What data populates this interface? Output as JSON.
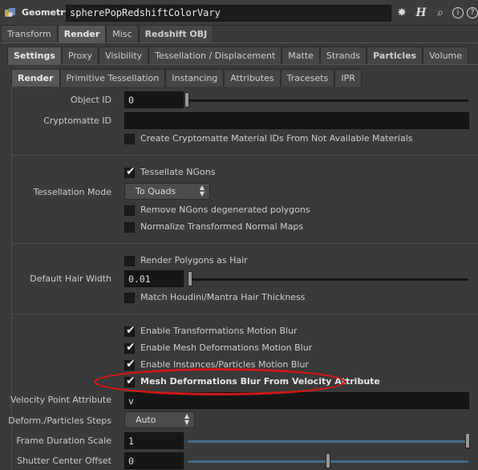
{
  "header": {
    "node_type": "Geometry",
    "node_name": "spherePopRedshiftColorVary",
    "icons": [
      "gear-icon",
      "help-h-icon",
      "search-icon",
      "info-icon",
      "help-icon"
    ]
  },
  "tabs_top": [
    {
      "label": "Transform",
      "active": false
    },
    {
      "label": "Render",
      "active": true
    },
    {
      "label": "Misc",
      "active": false
    },
    {
      "label": "Redshift OBJ",
      "active": false,
      "bold": true
    }
  ],
  "tabs_mid": [
    {
      "label": "Settings",
      "active": true
    },
    {
      "label": "Proxy",
      "active": false
    },
    {
      "label": "Visibility",
      "active": false
    },
    {
      "label": "Tessellation / Displacement",
      "active": false
    },
    {
      "label": "Matte",
      "active": false
    },
    {
      "label": "Strands",
      "active": false
    },
    {
      "label": "Particles",
      "active": false,
      "bold": true
    },
    {
      "label": "Volume",
      "active": false
    }
  ],
  "tabs_sub": [
    {
      "label": "Render",
      "active": true
    },
    {
      "label": "Primitive Tessellation",
      "active": false
    },
    {
      "label": "Instancing",
      "active": false
    },
    {
      "label": "Attributes",
      "active": false
    },
    {
      "label": "Tracesets",
      "active": false
    },
    {
      "label": "IPR",
      "active": false
    }
  ],
  "params": {
    "object_id": {
      "label": "Object ID",
      "value": "0",
      "slider_fraction": 0.0
    },
    "cryptomatte_id": {
      "label": "Cryptomatte ID",
      "value": ""
    },
    "create_crypto": {
      "label": "Create Cryptomatte Material IDs From Not Available Materials",
      "checked": false
    },
    "tessellate_ngons": {
      "label": "Tessellate NGons",
      "checked": true
    },
    "tessellation_mode": {
      "label": "Tessellation Mode",
      "value": "To Quads"
    },
    "remove_ngons": {
      "label": "Remove NGons degenerated polygons",
      "checked": false
    },
    "normalize_normals": {
      "label": "Normalize Transformed Normal Maps",
      "checked": false
    },
    "render_polygons_hair": {
      "label": "Render Polygons as Hair",
      "checked": false
    },
    "default_hair_width": {
      "label": "Default Hair Width",
      "value": "0.01"
    },
    "match_houdini": {
      "label": "Match Houdini/Mantra Hair Thickness",
      "checked": false
    },
    "enable_transform_mb": {
      "label": "Enable Transformations Motion Blur",
      "checked": true
    },
    "enable_mesh_mb": {
      "label": "Enable Mesh Deformations Motion Blur",
      "checked": true
    },
    "enable_instances_mb": {
      "label": "Enable Instances/Particles Motion Blur",
      "checked": true
    },
    "mesh_blur_velocity": {
      "label": "Mesh Deformations Blur From Velocity Attribute",
      "checked": true
    },
    "velocity_point_attr": {
      "label": "Velocity Point Attribute",
      "value": "v"
    },
    "deform_particles_steps": {
      "label": "Deform./Particles Steps",
      "value": "Auto"
    },
    "frame_duration_scale": {
      "label": "Frame Duration Scale",
      "value": "1",
      "slider_fraction": 1.0
    },
    "shutter_center_offset": {
      "label": "Shutter Center Offset",
      "value": "0",
      "slider_fraction": 0.5
    }
  }
}
